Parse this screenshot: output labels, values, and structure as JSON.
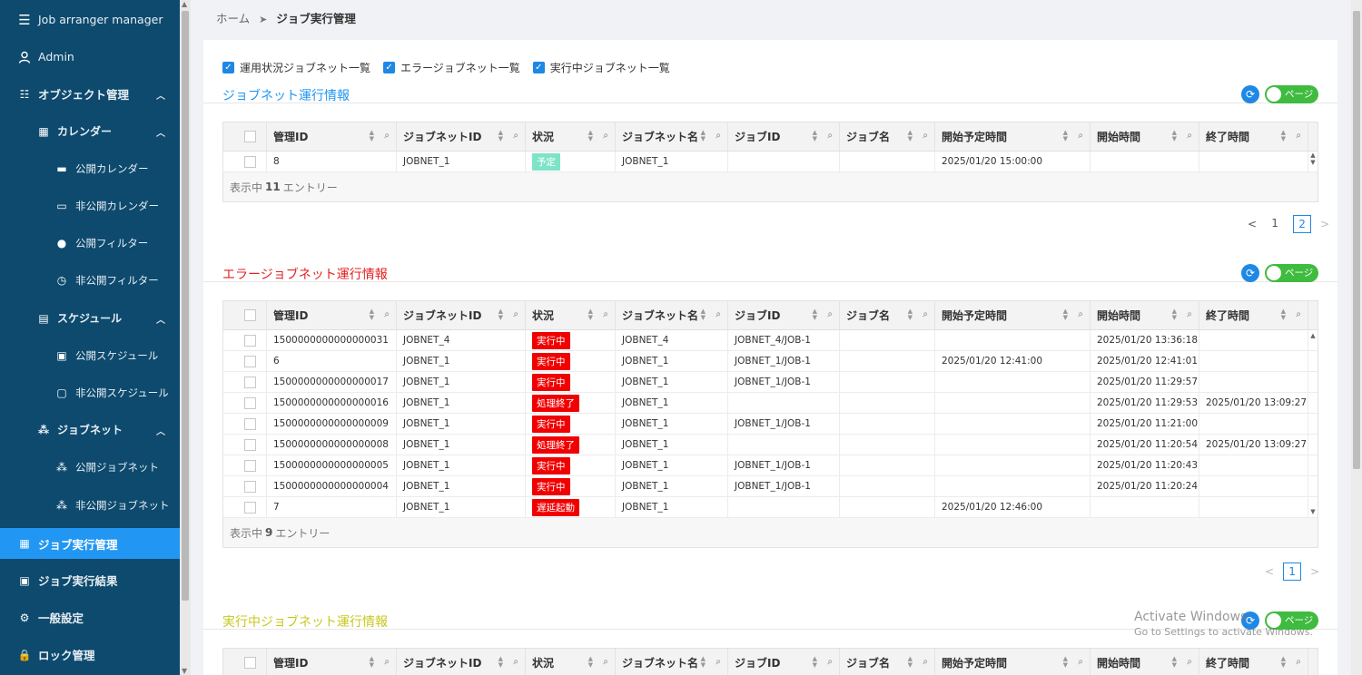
{
  "app": {
    "title": "Job arranger manager",
    "user": "Admin"
  },
  "sidebar": {
    "object_mgmt": "オブジェクト管理",
    "calendar": "カレンダー",
    "public_calendar": "公開カレンダー",
    "private_calendar": "非公開カレンダー",
    "public_filter": "公開フィルター",
    "private_filter": "非公開フィルター",
    "schedule": "スケジュール",
    "public_schedule": "公開スケジュール",
    "private_schedule": "非公開スケジュール",
    "jobnet": "ジョブネット",
    "public_jobnet": "公開ジョブネット",
    "private_jobnet": "非公開ジョブネット",
    "job_exec_mgmt": "ジョブ実行管理",
    "job_exec_result": "ジョブ実行結果",
    "general_settings": "一般設定",
    "lock_mgmt": "ロック管理"
  },
  "breadcrumb": {
    "home": "ホーム",
    "sep": "➤",
    "current": "ジョブ実行管理"
  },
  "filters": [
    "運用状況ジョブネット一覧",
    "エラージョブネット一覧",
    "実行中ジョブネット一覧"
  ],
  "columns": [
    "管理ID",
    "ジョブネットID",
    "状況",
    "ジョブネット名",
    "ジョブID",
    "ジョブ名",
    "開始予定時間",
    "開始時間",
    "終了時間"
  ],
  "toggle_label": "ページ",
  "sections": {
    "ops": {
      "title": "ジョブネット運行情報",
      "title_color": "#2196f3",
      "rows": [
        [
          "8",
          "JOBNET_1",
          "予定",
          "JOBNET_1",
          "",
          "",
          "2025/01/20 15:00:00",
          "",
          ""
        ]
      ],
      "footer_prefix": "表示中",
      "footer_count": "11",
      "footer_suffix": "エントリー",
      "pages": [
        "1",
        "2"
      ],
      "current_page": "2"
    },
    "error": {
      "title": "エラージョブネット運行情報",
      "title_color": "#e52020",
      "rows": [
        [
          "1500000000000000031",
          "JOBNET_4",
          "実行中",
          "JOBNET_4",
          "JOBNET_4/JOB-1",
          "",
          "",
          "2025/01/20 13:36:18",
          ""
        ],
        [
          "6",
          "JOBNET_1",
          "実行中",
          "JOBNET_1",
          "JOBNET_1/JOB-1",
          "",
          "2025/01/20 12:41:00",
          "2025/01/20 12:41:01",
          ""
        ],
        [
          "1500000000000000017",
          "JOBNET_1",
          "実行中",
          "JOBNET_1",
          "JOBNET_1/JOB-1",
          "",
          "",
          "2025/01/20 11:29:57",
          ""
        ],
        [
          "1500000000000000016",
          "JOBNET_1",
          "処理終了",
          "JOBNET_1",
          "",
          "",
          "",
          "2025/01/20 11:29:53",
          "2025/01/20 13:09:27"
        ],
        [
          "1500000000000000009",
          "JOBNET_1",
          "実行中",
          "JOBNET_1",
          "JOBNET_1/JOB-1",
          "",
          "",
          "2025/01/20 11:21:00",
          ""
        ],
        [
          "1500000000000000008",
          "JOBNET_1",
          "処理終了",
          "JOBNET_1",
          "",
          "",
          "",
          "2025/01/20 11:20:54",
          "2025/01/20 13:09:27"
        ],
        [
          "1500000000000000005",
          "JOBNET_1",
          "実行中",
          "JOBNET_1",
          "JOBNET_1/JOB-1",
          "",
          "",
          "2025/01/20 11:20:43",
          ""
        ],
        [
          "1500000000000000004",
          "JOBNET_1",
          "実行中",
          "JOBNET_1",
          "JOBNET_1/JOB-1",
          "",
          "",
          "2025/01/20 11:20:24",
          ""
        ],
        [
          "7",
          "JOBNET_1",
          "遅延起動",
          "JOBNET_1",
          "",
          "",
          "2025/01/20 12:46:00",
          "",
          ""
        ]
      ],
      "footer_prefix": "表示中",
      "footer_count": "9",
      "footer_suffix": "エントリー",
      "pages": [
        "1"
      ],
      "current_page": "1"
    },
    "running": {
      "title": "実行中ジョブネット運行情報",
      "title_color": "#c8c81e"
    }
  },
  "status_colors": {
    "予定": "#7fe3c8",
    "実行中": "#f00000",
    "処理終了": "#f00000",
    "遅延起動": "#f00000"
  },
  "watermark": {
    "line1": "Activate Windows",
    "line2": "Go to Settings to activate Windows."
  }
}
